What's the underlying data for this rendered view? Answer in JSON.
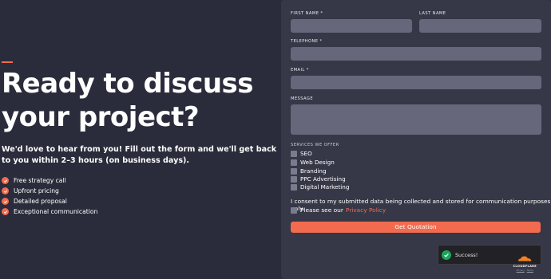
{
  "left": {
    "headline": "Ready to discuss your project?",
    "subtitle": "We'd love to hear from you! Fill out the form and we'll get back to you within 2–3 hours (on business days).",
    "benefits": [
      "Free strategy call",
      "Upfront pricing",
      "Detailed proposal",
      "Exceptional communication"
    ]
  },
  "form": {
    "first_name_label": "FIRST NAME",
    "last_name_label": "LAST NAME",
    "telephone_label": "TELEPHONE",
    "email_label": "EMAIL",
    "message_label": "MESSAGE",
    "required_mark": "*",
    "services_title": "SERVICES WE OFFER",
    "services": [
      "SEO",
      "Web Design",
      "Branding",
      "PPC Advertising",
      "Digital Marketing"
    ],
    "consent_text": "I consent to my submitted data being collected and stored for communication purposes only.",
    "see_also_text": "Please see our",
    "privacy_link": "Privacy Policy",
    "submit_label": "Get Quotation"
  },
  "captcha": {
    "status": "Success!",
    "brand": "CLOUDFLARE",
    "privacy": "Privacy",
    "terms": "Terms",
    "separator": "·"
  },
  "colors": {
    "background": "#2b2c3b",
    "panel": "#363747",
    "field": "#66677a",
    "accent": "#f26b4f",
    "success": "#1aa55b"
  }
}
